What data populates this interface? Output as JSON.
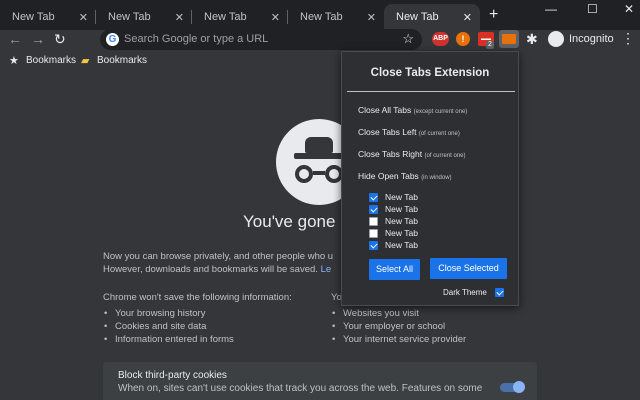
{
  "tabs": [
    {
      "label": "New Tab",
      "close": "✕"
    },
    {
      "label": "New Tab",
      "close": "✕"
    },
    {
      "label": "New Tab",
      "close": "✕"
    },
    {
      "label": "New Tab",
      "close": "✕"
    },
    {
      "label": "New Tab",
      "close": "✕"
    }
  ],
  "window_controls": {
    "minimize": "—",
    "maximize": "☐",
    "close": "✕",
    "new_tab": "+"
  },
  "toolbar": {
    "back": "←",
    "forward": "→",
    "reload": "↻",
    "omnibox_text": "Search Google or type a URL",
    "google_icon": "G",
    "star": "☆",
    "extensions": [
      {
        "name": "adblock-plus",
        "label": "ABP",
        "color": "#d0332f"
      },
      {
        "name": "alert-extension",
        "label": "!",
        "color": "#e8710a"
      },
      {
        "name": "todo-extension",
        "label": "▬▬",
        "color": "#d93025",
        "badge": "2"
      },
      {
        "name": "close-tabs-extension",
        "label": "",
        "color": "#e8710a"
      }
    ],
    "puzzle": "✱",
    "profile_label": "Incognito",
    "menu": "⋮"
  },
  "bookmarks": [
    {
      "label": "Bookmarks",
      "icon": "star-icon",
      "glyph": "★",
      "color": "#e8eaed"
    },
    {
      "label": "Bookmarks",
      "icon": "folder-icon",
      "glyph": "▰",
      "color": "#f5c542"
    }
  ],
  "page": {
    "title": "You've gone in",
    "line1": "Now you can browse privately, and other people who u",
    "line2_prefix": "However, downloads and bookmarks will be saved.",
    "line2_link": "Le",
    "left_heading": "Chrome won't save the following information:",
    "right_heading": "Yo",
    "left_bullets": [
      "Your browsing history",
      "Cookies and site data",
      "Information entered in forms"
    ],
    "right_bullets": [
      "Websites you visit",
      "Your employer or school",
      "Your internet service provider"
    ],
    "cookie_title": "Block third-party cookies",
    "cookie_desc": "When on, sites can't use cookies that track you across the web. Features on some",
    "cookie_toggle_on": true
  },
  "popup": {
    "title": "Close Tabs Extension",
    "actions": [
      {
        "label": "Close All Tabs",
        "note": "(except current one)"
      },
      {
        "label": "Close Tabs Left",
        "note": "(of current one)"
      },
      {
        "label": "Close Tabs Right",
        "note": "(of current one)"
      },
      {
        "label": "Hide Open Tabs",
        "note": "(in window)"
      }
    ],
    "tab_list": [
      {
        "label": "New Tab",
        "checked": true
      },
      {
        "label": "New Tab",
        "checked": true
      },
      {
        "label": "New Tab",
        "checked": false
      },
      {
        "label": "New Tab",
        "checked": false
      },
      {
        "label": "New Tab",
        "checked": true
      }
    ],
    "select_all": "Select All",
    "close_selected": "Close Selected",
    "dark_theme_label": "Dark Theme",
    "dark_theme_checked": true
  }
}
